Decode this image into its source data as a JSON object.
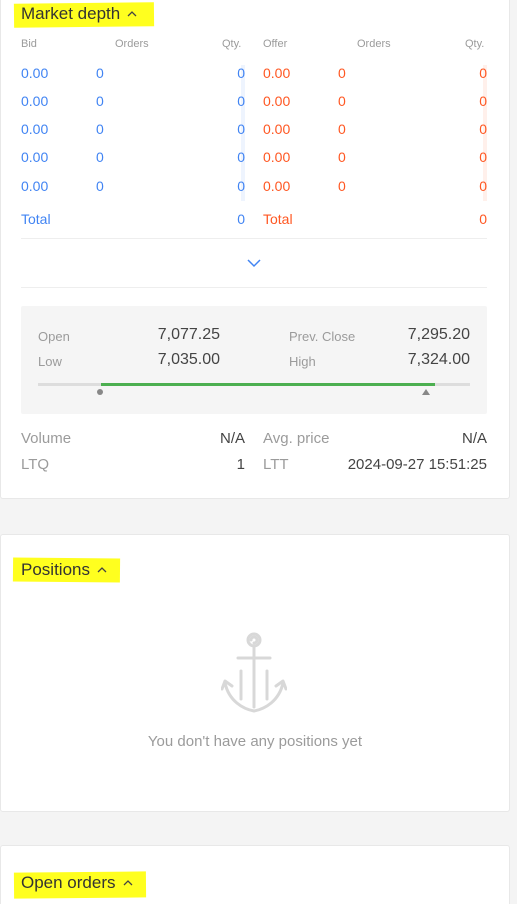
{
  "market_depth": {
    "title": "Market depth",
    "bid_headers": [
      "Bid",
      "Orders",
      "Qty."
    ],
    "offer_headers": [
      "Offer",
      "Orders",
      "Qty."
    ],
    "bids": [
      {
        "price": "0.00",
        "orders": "0",
        "qty": "0"
      },
      {
        "price": "0.00",
        "orders": "0",
        "qty": "0"
      },
      {
        "price": "0.00",
        "orders": "0",
        "qty": "0"
      },
      {
        "price": "0.00",
        "orders": "0",
        "qty": "0"
      },
      {
        "price": "0.00",
        "orders": "0",
        "qty": "0"
      }
    ],
    "offers": [
      {
        "price": "0.00",
        "orders": "0",
        "qty": "0"
      },
      {
        "price": "0.00",
        "orders": "0",
        "qty": "0"
      },
      {
        "price": "0.00",
        "orders": "0",
        "qty": "0"
      },
      {
        "price": "0.00",
        "orders": "0",
        "qty": "0"
      },
      {
        "price": "0.00",
        "orders": "0",
        "qty": "0"
      }
    ],
    "bid_total_label": "Total",
    "bid_total_qty": "0",
    "offer_total_label": "Total",
    "offer_total_qty": "0"
  },
  "ohlc": {
    "open_label": "Open",
    "open_value": "7,077.25",
    "prev_close_label": "Prev. Close",
    "prev_close_value": "7,295.20",
    "low_label": "Low",
    "low_value": "7,035.00",
    "high_label": "High",
    "high_value": "7,324.00",
    "range_fill_start_fraction": 0.145,
    "range_fill_end_fraction": 0.92
  },
  "stats": {
    "volume_label": "Volume",
    "volume_value": "N/A",
    "avg_price_label": "Avg. price",
    "avg_price_value": "N/A",
    "ltq_label": "LTQ",
    "ltq_value": "1",
    "ltt_label": "LTT",
    "ltt_value": "2024-09-27 15:51:25"
  },
  "positions": {
    "title": "Positions",
    "empty_message": "You don't have any positions yet",
    "empty_icon": "anchor-icon"
  },
  "open_orders": {
    "title": "Open orders"
  },
  "colors": {
    "bid": "#4184f3",
    "offer": "#ff5722",
    "range_fill": "#4caf50",
    "highlight": "#ffff1f"
  }
}
